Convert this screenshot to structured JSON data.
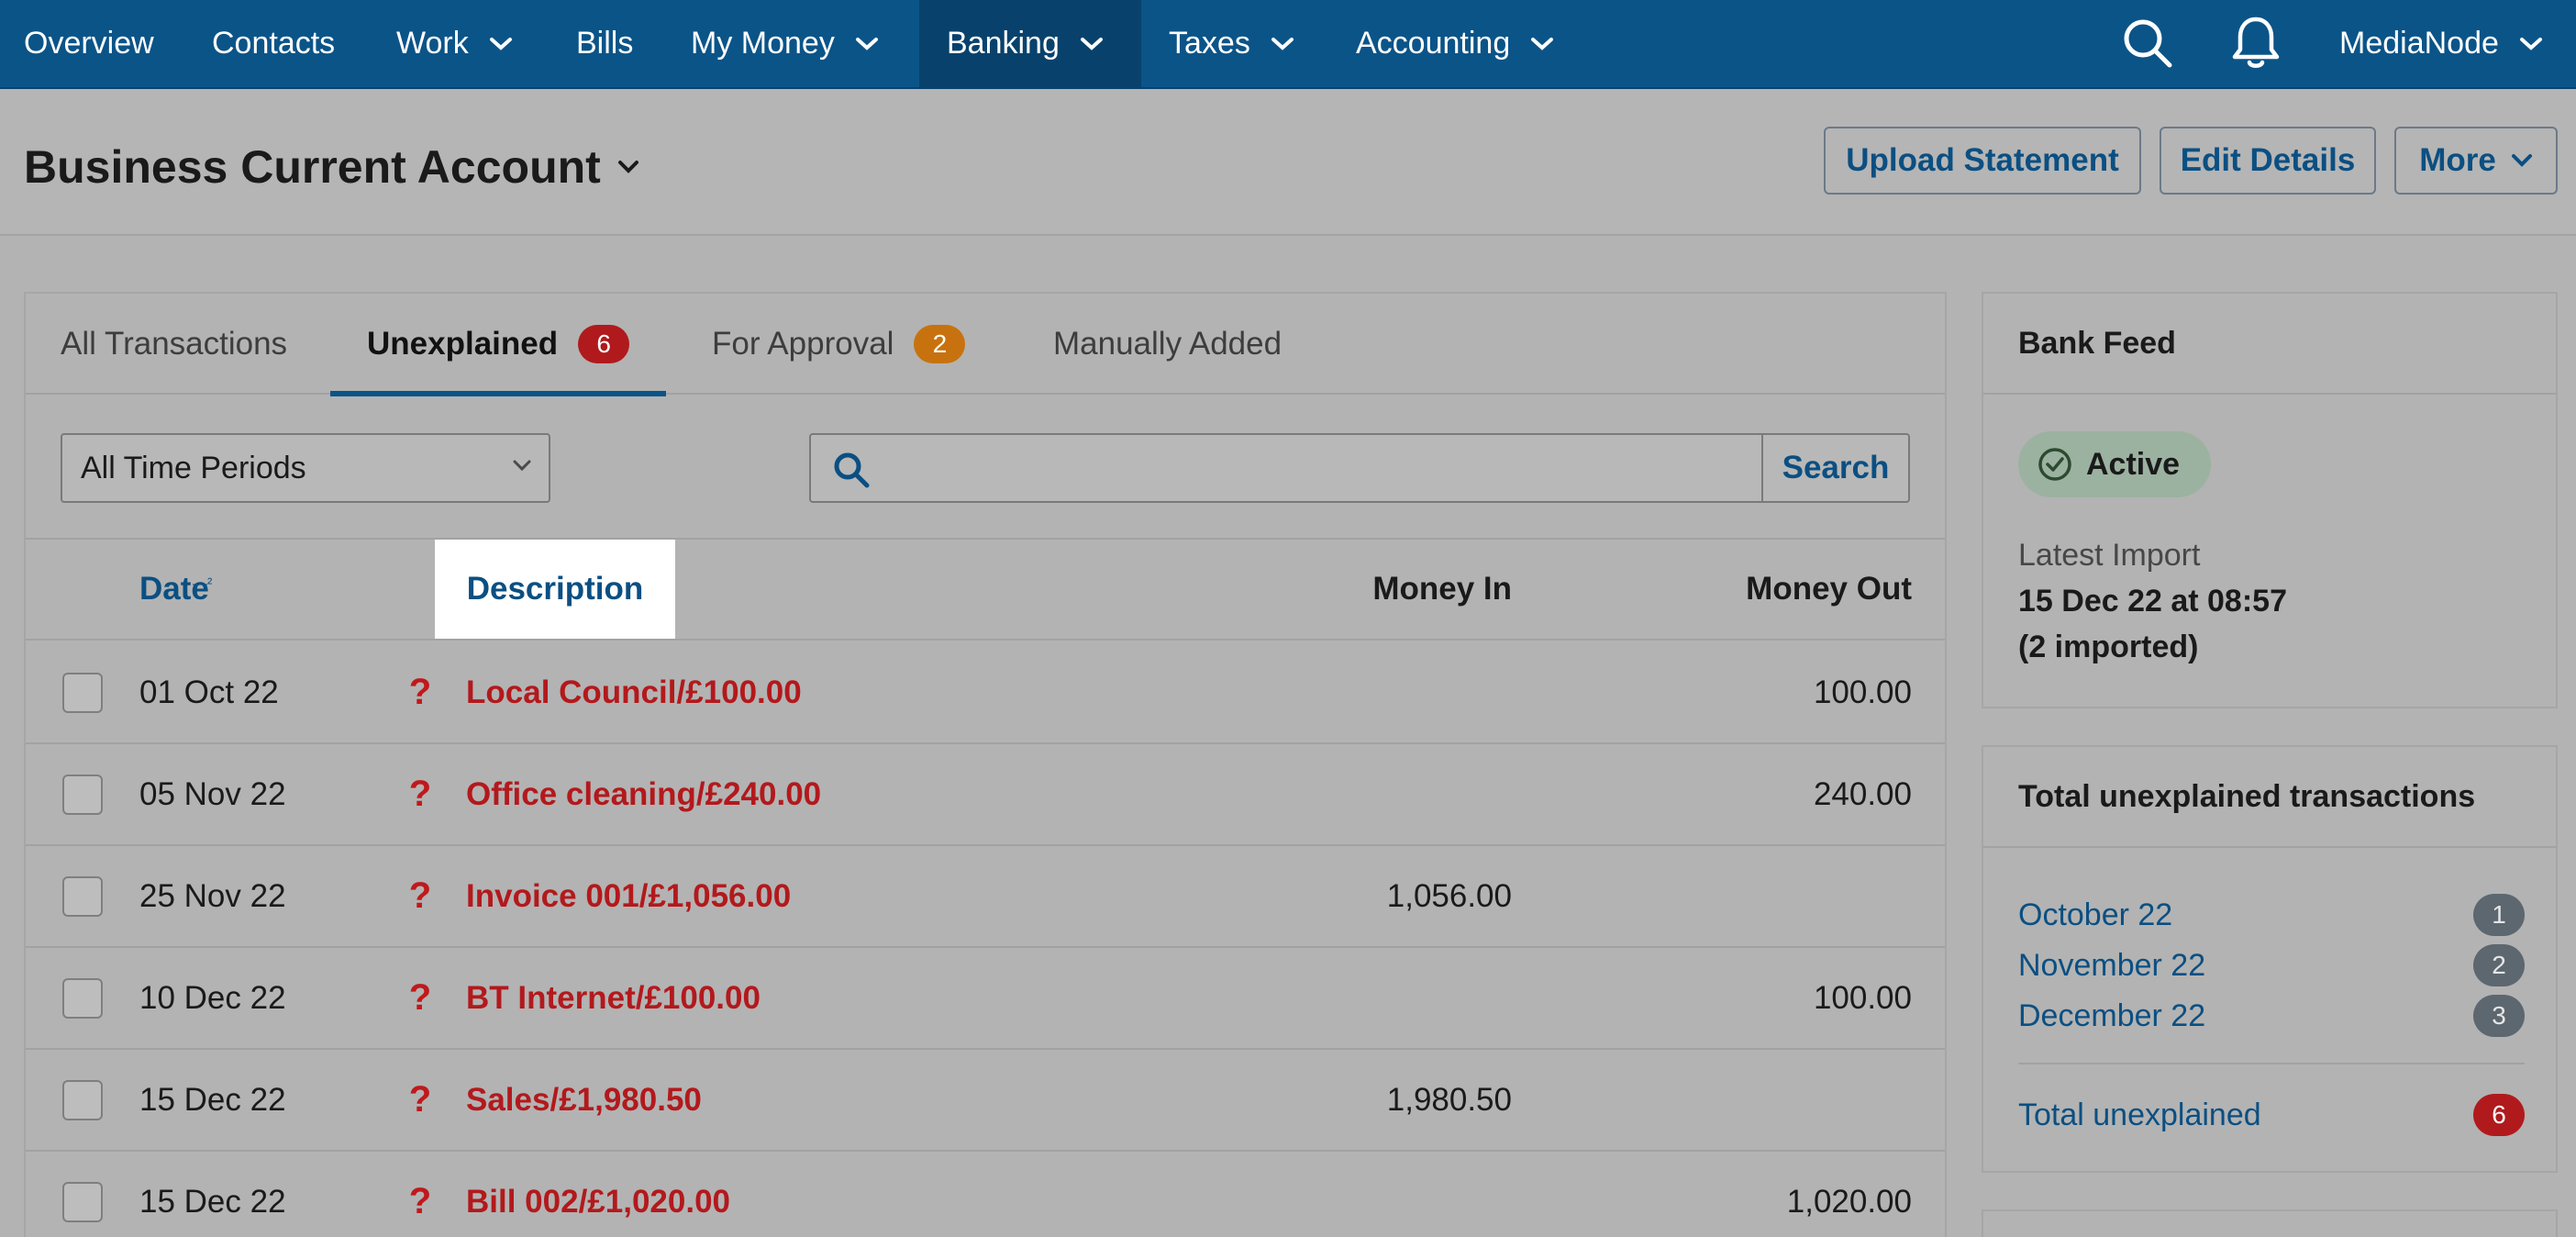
{
  "nav": {
    "items": [
      {
        "label": "Overview",
        "has_dropdown": false
      },
      {
        "label": "Contacts",
        "has_dropdown": false
      },
      {
        "label": "Work",
        "has_dropdown": true
      },
      {
        "label": "Bills",
        "has_dropdown": false
      },
      {
        "label": "My Money",
        "has_dropdown": true
      },
      {
        "label": "Banking",
        "has_dropdown": true,
        "active": true
      },
      {
        "label": "Taxes",
        "has_dropdown": true
      },
      {
        "label": "Accounting",
        "has_dropdown": true
      }
    ],
    "icons": [
      "search-icon",
      "bell-icon"
    ],
    "account_label": "MediaNode"
  },
  "header": {
    "title": "Business Current Account",
    "buttons": {
      "upload": "Upload Statement",
      "edit": "Edit Details",
      "more": "More"
    }
  },
  "tabs": [
    {
      "label": "All Transactions"
    },
    {
      "label": "Unexplained",
      "badge": "6",
      "active": true
    },
    {
      "label": "For Approval",
      "badge": "2"
    },
    {
      "label": "Manually Added"
    }
  ],
  "filters": {
    "period": "All Time Periods",
    "search_value": "",
    "search_button": "Search"
  },
  "table": {
    "columns": {
      "date": "Date",
      "description": "Description",
      "money_in": "Money In",
      "money_out": "Money Out"
    },
    "rows": [
      {
        "date": "01 Oct 22",
        "flag": "?",
        "description": "Local Council/£100.00",
        "money_in": "",
        "money_out": "100.00"
      },
      {
        "date": "05 Nov 22",
        "flag": "?",
        "description": "Office cleaning/£240.00",
        "money_in": "",
        "money_out": "240.00"
      },
      {
        "date": "25 Nov 22",
        "flag": "?",
        "description": "Invoice 001/£1,056.00",
        "money_in": "1,056.00",
        "money_out": ""
      },
      {
        "date": "10 Dec 22",
        "flag": "?",
        "description": "BT Internet/£100.00",
        "money_in": "",
        "money_out": "100.00"
      },
      {
        "date": "15 Dec 22",
        "flag": "?",
        "description": "Sales/£1,980.50",
        "money_in": "1,980.50",
        "money_out": ""
      },
      {
        "date": "15 Dec 22",
        "flag": "?",
        "description": "Bill 002/£1,020.00",
        "money_in": "",
        "money_out": "1,020.00"
      }
    ]
  },
  "bank_feed": {
    "title": "Bank Feed",
    "status": "Active",
    "latest_label": "Latest Import",
    "latest_value": "15 Dec 22 at 08:57",
    "imported_note": "(2 imported)"
  },
  "unexplained": {
    "title": "Total unexplained transactions",
    "months": [
      {
        "label": "October 22",
        "count": "1"
      },
      {
        "label": "November 22",
        "count": "2"
      },
      {
        "label": "December 22",
        "count": "3"
      }
    ],
    "total_label": "Total unexplained",
    "total_count": "6"
  },
  "colors": {
    "nav_bg": "#0b5488",
    "link": "#0b4f82",
    "danger": "#b3191c",
    "warning_badge": "#c8720f"
  }
}
